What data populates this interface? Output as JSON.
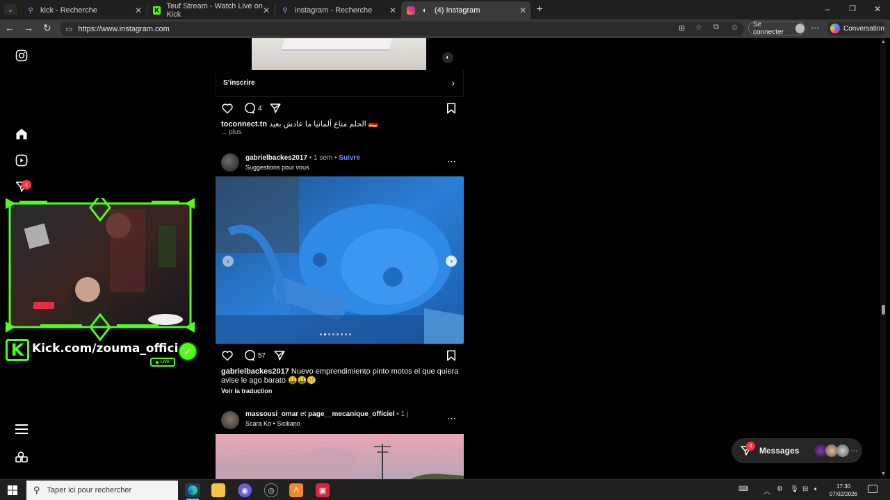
{
  "tabs": [
    {
      "title": "kick - Recherche"
    },
    {
      "title": "Teuf Stream - Watch Live on Kick"
    },
    {
      "title": "instagram - Recherche"
    },
    {
      "title": "(4) Instagram"
    }
  ],
  "address": {
    "url": "https://www.instagram.com"
  },
  "toolbar": {
    "signin_label": "Se connecter",
    "conversation_label": "Conversation"
  },
  "sidebar": {
    "notifications_badge": "4"
  },
  "overlay": {
    "kick_text": "Kick.com/zouma_officiel",
    "live_badge": "LIVE"
  },
  "post1": {
    "cta_label": "S’inscrire",
    "comments_count": "4",
    "caption_user": "toconnect.tn",
    "caption_text": "الحلم متاع ألمانيا ما عادش بعيد 🇩🇪",
    "more_label": "... plus"
  },
  "post2": {
    "username": "gabrielbackes2017",
    "time": "• 1 sem •",
    "follow_label": "Suivre",
    "subtitle": "Suggestions pour vous",
    "comments_count": "57",
    "caption_user": "gabrielbackes2017",
    "caption_text": "Nuevo emprendimiento pinto motos el que quiera avise le ago barato 🤑🤑🤫",
    "translate_label": "Voir la traduction"
  },
  "post3": {
    "username1": "massousi_omar",
    "joiner": "et",
    "username2": "page__mecanique_officiel",
    "time": "• 1 j",
    "music_artist": "Scara Ko",
    "music_sep": "•",
    "music_title": "Siciliano"
  },
  "messages": {
    "label": "Messages",
    "badge": "4"
  },
  "taskbar": {
    "search_placeholder": "Taper ici pour rechercher",
    "time": "17:30",
    "date": "07/02/2026"
  },
  "colors": {
    "accent_blue": "#7b8cff",
    "badge_red": "#ff3040",
    "kick_green": "#53fc18"
  }
}
